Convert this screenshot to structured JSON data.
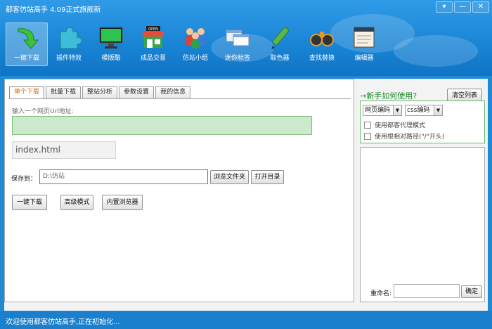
{
  "window": {
    "title": "都客仿站高手 4.09正式旗舰新"
  },
  "controls": {
    "menu": "▾",
    "minimize": "—",
    "close": "✕"
  },
  "toolbar": [
    {
      "label": "一键下载",
      "icon": "download-arrow-icon",
      "active": true
    },
    {
      "label": "插件特效",
      "icon": "puzzle-plugin-icon"
    },
    {
      "label": "模版酷",
      "icon": "monitor-template-icon"
    },
    {
      "label": "成品交易",
      "icon": "open-shop-icon"
    },
    {
      "label": "仿站小组",
      "icon": "people-group-icon"
    },
    {
      "label": "迷你标签",
      "icon": "windows-tags-icon"
    },
    {
      "label": "取色器",
      "icon": "color-picker-icon"
    },
    {
      "label": "查找替换",
      "icon": "binoculars-search-icon"
    },
    {
      "label": "编辑器",
      "icon": "notebook-editor-icon"
    }
  ],
  "tabs": [
    {
      "label": "单个下载",
      "active": true
    },
    {
      "label": "批量下载"
    },
    {
      "label": "整站分析"
    },
    {
      "label": "参数设置"
    },
    {
      "label": "我的信息"
    }
  ],
  "form": {
    "url_label": "输入一个网页Url地址:",
    "url_value": "",
    "filename_value": "index.html",
    "save_label": "保存到：",
    "save_value": "D:\\仿站",
    "browse_button": "浏览文件夹",
    "open_dir_button": "打开目录",
    "download_button": "一键下载",
    "advanced_button": "高级模式",
    "browser_button": "内置浏览器"
  },
  "right_panel": {
    "howto": "→新手如何使用?",
    "clear_button": "清空列表",
    "page_encoding": "网页编码",
    "css_encoding": "css编码",
    "checkboxes": [
      "使用都客代理模式",
      "使用根相对路径(\"/\"开头)"
    ],
    "rename_label": "重命名:",
    "ok_button": "确定"
  },
  "status": {
    "text": "欢迎使用都客仿站高手,正在初始化..."
  },
  "colors": {
    "accent": "#1b86d6",
    "active_tab": "#e06b00",
    "url_field": "#cde9cc",
    "howto": "#1d8a2a"
  }
}
